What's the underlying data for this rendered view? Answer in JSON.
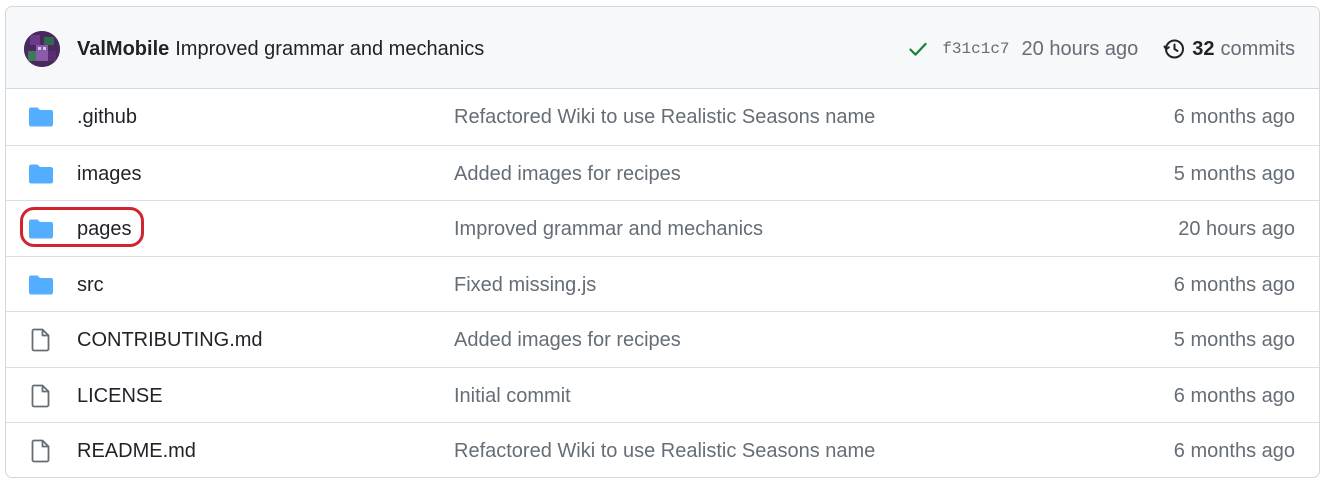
{
  "header": {
    "author": "ValMobile",
    "message": "Improved grammar and mechanics",
    "sha": "f31c1c7",
    "time": "20 hours ago",
    "commit_count": "32",
    "commits_label": "commits",
    "status_icon": "check-icon",
    "history_icon": "history-icon"
  },
  "files": [
    {
      "type": "folder",
      "name": ".github",
      "message": "Refactored Wiki to use Realistic Seasons name",
      "date": "6 months ago"
    },
    {
      "type": "folder",
      "name": "images",
      "message": "Added images for recipes",
      "date": "5 months ago"
    },
    {
      "type": "folder",
      "name": "pages",
      "message": "Improved grammar and mechanics",
      "date": "20 hours ago",
      "highlighted": true
    },
    {
      "type": "folder",
      "name": "src",
      "message": "Fixed missing.js",
      "date": "6 months ago"
    },
    {
      "type": "file",
      "name": "CONTRIBUTING.md",
      "message": "Added images for recipes",
      "date": "5 months ago"
    },
    {
      "type": "file",
      "name": "LICENSE",
      "message": "Initial commit",
      "date": "6 months ago"
    },
    {
      "type": "file",
      "name": "README.md",
      "message": "Refactored Wiki to use Realistic Seasons name",
      "date": "6 months ago"
    }
  ],
  "colors": {
    "folder": "#54aeff",
    "file": "#656d76",
    "check": "#1a7f37",
    "highlight": "#d1242f"
  }
}
